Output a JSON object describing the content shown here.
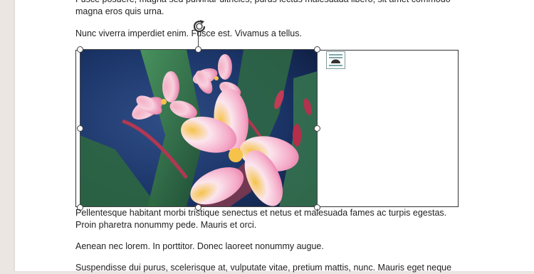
{
  "document": {
    "paragraphs": {
      "p0_line1": "Fusce posuere, magna sed pulvinar ultricies, purus lectus malesuada libero, sit amet commodo",
      "p0_line2": "magna eros quis urna.",
      "p1": "Nunc viverra imperdiet enim. Fusce est. Vivamus a tellus.",
      "p2_line1": "Pellentesque habitant morbi tristique senectus et netus et malesuada fames ac turpis egestas.",
      "p2_line2": "Proin pharetra nonummy pede. Mauris et orci.",
      "p3": "Aenean nec lorem. In porttitor. Donec laoreet nonummy augue.",
      "p4": "Suspendisse dui purus, scelerisque at, vulputate vitae, pretium mattis, nunc. Mauris eget neque"
    }
  },
  "image": {
    "icons": {
      "rotate": "rotate-icon",
      "layout_options": "layout-options-icon"
    },
    "colors": {
      "background": "#1b3568",
      "leaf": "#3f8050",
      "petal_pink": "#f28eb5",
      "petal_light": "#fbe6ee",
      "center_yellow": "#f6c34a"
    }
  },
  "colors": {
    "app_background": "#ece6e3",
    "page": "#ffffff",
    "text": "#222222",
    "selection": "#444444"
  }
}
